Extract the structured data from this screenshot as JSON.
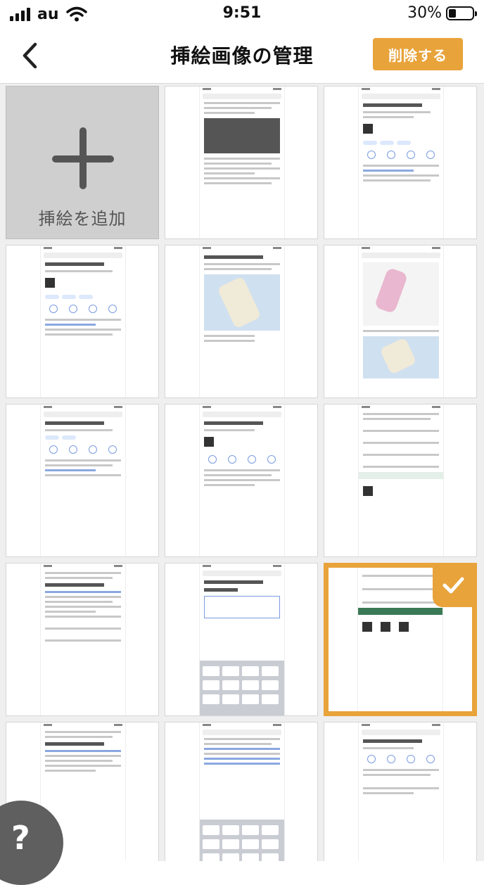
{
  "status_bar": {
    "carrier": "au",
    "time": "9:51",
    "battery_percent": "30%",
    "battery_level": 0.3
  },
  "nav": {
    "title": "挿絵画像の管理",
    "delete_label": "削除する",
    "back_icon": "chevron-left-icon"
  },
  "add_tile": {
    "label": "挿絵を追加",
    "icon": "plus-icon"
  },
  "tiles": [
    {
      "kind": "article"
    },
    {
      "kind": "place"
    },
    {
      "kind": "place"
    },
    {
      "kind": "map"
    },
    {
      "kind": "pinkmap"
    },
    {
      "kind": "place"
    },
    {
      "kind": "place"
    },
    {
      "kind": "list"
    },
    {
      "kind": "article"
    },
    {
      "kind": "keyboard"
    },
    {
      "kind": "list",
      "selected": true
    },
    {
      "kind": "article"
    },
    {
      "kind": "keyboard"
    },
    {
      "kind": "page"
    }
  ],
  "help": {
    "label": "?"
  },
  "colors": {
    "accent": "#e8a33a",
    "add_tile_bg": "#cfcfcf",
    "plus": "#555555"
  }
}
